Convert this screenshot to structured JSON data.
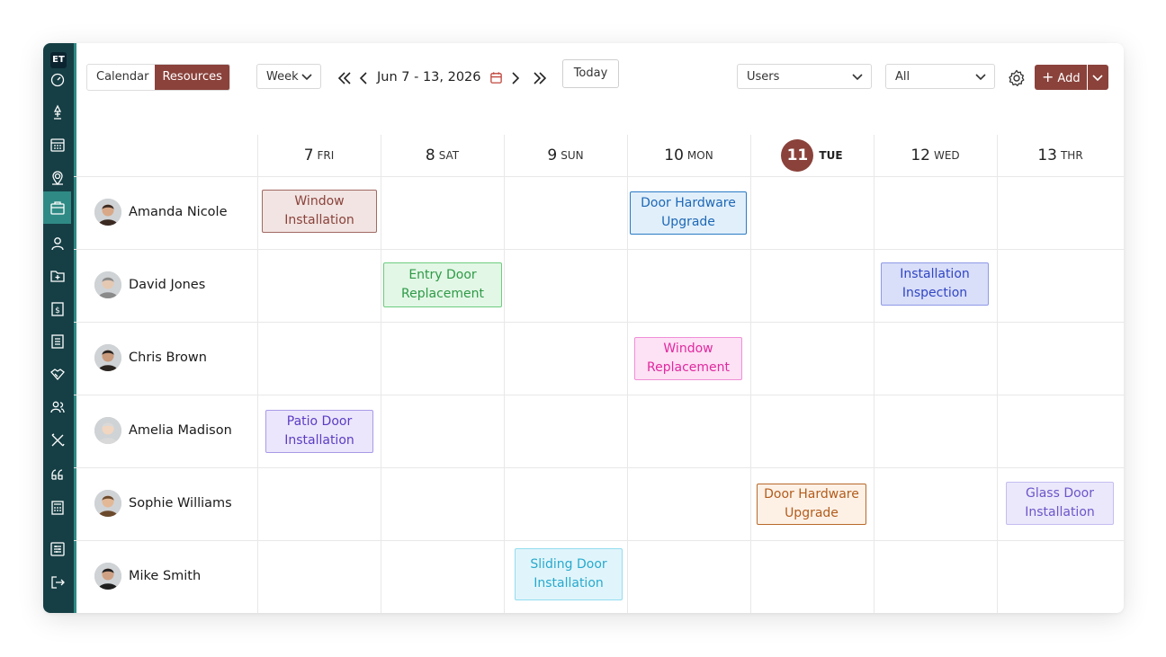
{
  "app": {
    "logo": "ET"
  },
  "sidebar": {
    "icons": [
      "dashboard-icon",
      "lamp-icon",
      "calendar-icon",
      "map-pin-icon",
      "briefcase-icon",
      "user-icon",
      "folder-icon",
      "invoice-icon",
      "document-icon",
      "handshake-icon",
      "users-icon",
      "tools-icon",
      "quote-icon",
      "calculator-icon",
      "settings-sliders-icon",
      "logout-icon"
    ],
    "active": "briefcase-icon"
  },
  "toolbar": {
    "view_tabs": [
      {
        "label": "Calendar",
        "active": false
      },
      {
        "label": "Resources",
        "active": true
      }
    ],
    "range_select": "Week",
    "date_range": "Jun 7 - 13, 2026",
    "today_label": "Today",
    "users_select": "Users",
    "filter_select": "All",
    "add_label": "Add",
    "accent": "#8a423b"
  },
  "days": [
    {
      "num": "7",
      "dow": "FRI",
      "today": false
    },
    {
      "num": "8",
      "dow": "SAT",
      "today": false
    },
    {
      "num": "9",
      "dow": "SUN",
      "today": false
    },
    {
      "num": "10",
      "dow": "MON",
      "today": false
    },
    {
      "num": "11",
      "dow": "TUE",
      "today": true
    },
    {
      "num": "12",
      "dow": "WED",
      "today": false
    },
    {
      "num": "13",
      "dow": "THR",
      "today": false
    }
  ],
  "people": [
    {
      "name": "Amanda Nicole"
    },
    {
      "name": "David Jones"
    },
    {
      "name": "Chris Brown"
    },
    {
      "name": "Amelia Madison"
    },
    {
      "name": "Sophie Williams"
    },
    {
      "name": "Mike Smith"
    }
  ],
  "events": [
    {
      "title": "Window Installation",
      "person": 0,
      "day": 0,
      "bg": "#f1e4e2",
      "border": "#a16a63",
      "color": "#8a423b"
    },
    {
      "title": "Door Hardware Upgrade",
      "person": 0,
      "day": 3,
      "bg": "#e1effb",
      "border": "#2a7bc4",
      "color": "#1d68b5"
    },
    {
      "title": "Entry Door Replacement",
      "person": 1,
      "day": 1,
      "bg": "#e3f7e6",
      "border": "#6ccc7f",
      "color": "#2e9a47"
    },
    {
      "title": "Installation Inspection",
      "person": 1,
      "day": 5,
      "bg": "#d9def9",
      "border": "#8e9ae6",
      "color": "#3046c2"
    },
    {
      "title": "Window Replacement",
      "person": 2,
      "day": 3,
      "bg": "#fde1f4",
      "border": "#ef8fd6",
      "color": "#e0299f"
    },
    {
      "title": "Patio Door Installation",
      "person": 3,
      "day": 0,
      "bg": "#ebe6fb",
      "border": "#a99ae8",
      "color": "#5b3cc4"
    },
    {
      "title": "Door Hardware Upgrade",
      "person": 4,
      "day": 4,
      "bg": "#fdf1e6",
      "border": "#b86a2a",
      "color": "#b25c1b"
    },
    {
      "title": "Glass Door Installation",
      "person": 4,
      "day": 6,
      "bg": "#ebe8fb",
      "border": "#c5bdf1",
      "color": "#6c55c9"
    },
    {
      "title": "Sliding Door Installation",
      "person": 5,
      "day": 2,
      "bg": "#e0f5fb",
      "border": "#94dcef",
      "color": "#28a9cd"
    }
  ]
}
